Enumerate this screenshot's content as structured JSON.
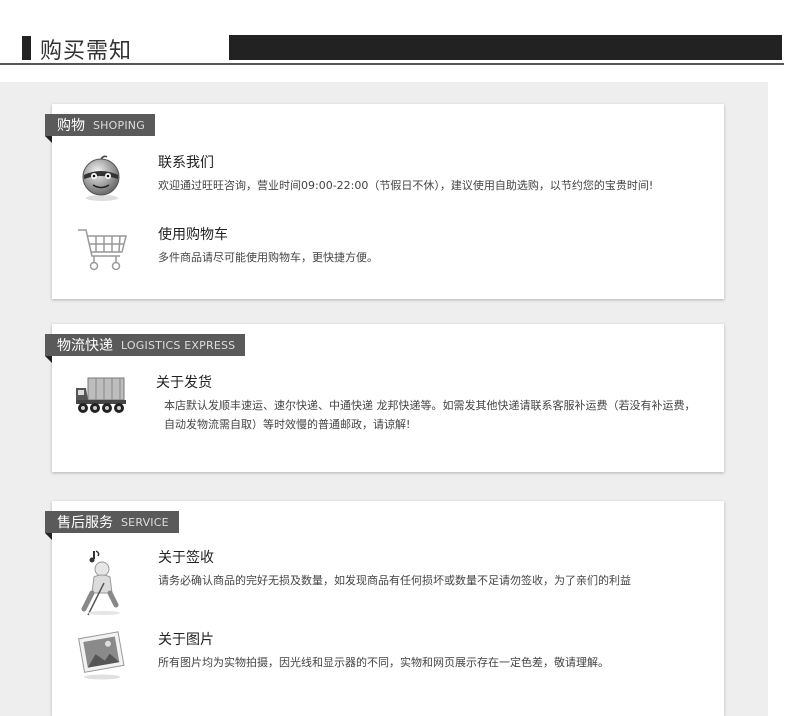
{
  "header": {
    "title": "购买需知"
  },
  "sections": [
    {
      "tab_cn": "购物",
      "tab_en": "SHOPING",
      "items": [
        {
          "icon": "smiley-face-icon",
          "title": "联系我们",
          "desc": "欢迎通过旺旺咨询，营业时间09:00-22:00（节假日不休），建议使用自助选购，以节约您的宝贵时间!"
        },
        {
          "icon": "shopping-cart-icon",
          "title": "使用购物车",
          "desc": "多件商品请尽可能使用购物车，更快捷方便。"
        }
      ]
    },
    {
      "tab_cn": "物流快递",
      "tab_en": "LOGISTICS EXPRESS",
      "items": [
        {
          "icon": "delivery-truck-icon",
          "title": "关于发货",
          "desc": "本店默认发顺丰速运、速尔快递、中通快递 龙邦快递等。如需发其他快递请联系客服补运费（若没有补运费，自动发物流需自取）等时效慢的普通邮政，请谅解!"
        }
      ]
    },
    {
      "tab_cn": "售后服务",
      "tab_en": "SERVICE",
      "items": [
        {
          "icon": "person-signing-icon",
          "title": "关于签收",
          "desc": "请务必确认商品的完好无损及数量，如发现商品有任何损坏或数量不足请勿签收，为了亲们的利益"
        },
        {
          "icon": "photo-frame-icon",
          "title": "关于图片",
          "desc": "所有图片均为实物拍摄，因光线和显示器的不同，实物和网页展示存在一定色差，敬请理解。"
        }
      ]
    }
  ]
}
